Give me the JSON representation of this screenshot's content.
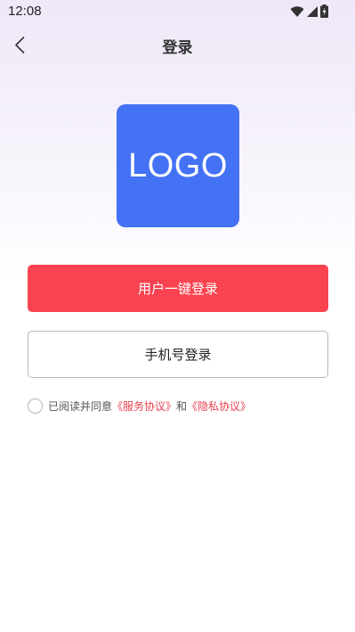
{
  "status_bar": {
    "time": "12:08",
    "icons": [
      "wifi-icon",
      "cellular-signal-icon",
      "battery-charging-icon"
    ]
  },
  "header": {
    "title": "登录",
    "back_icon": "chevron-left-icon"
  },
  "logo": {
    "text": "LOGO",
    "color": "#4472f5"
  },
  "buttons": {
    "one_click_label": "用户一键登录",
    "one_click_color": "#fa4350",
    "phone_label": "手机号登录"
  },
  "agreement": {
    "prefix": "已阅读并同意",
    "service_link": "《服务协议》",
    "conjunction": "和",
    "privacy_link": "《隐私协议》",
    "link_color": "#e8424e"
  }
}
